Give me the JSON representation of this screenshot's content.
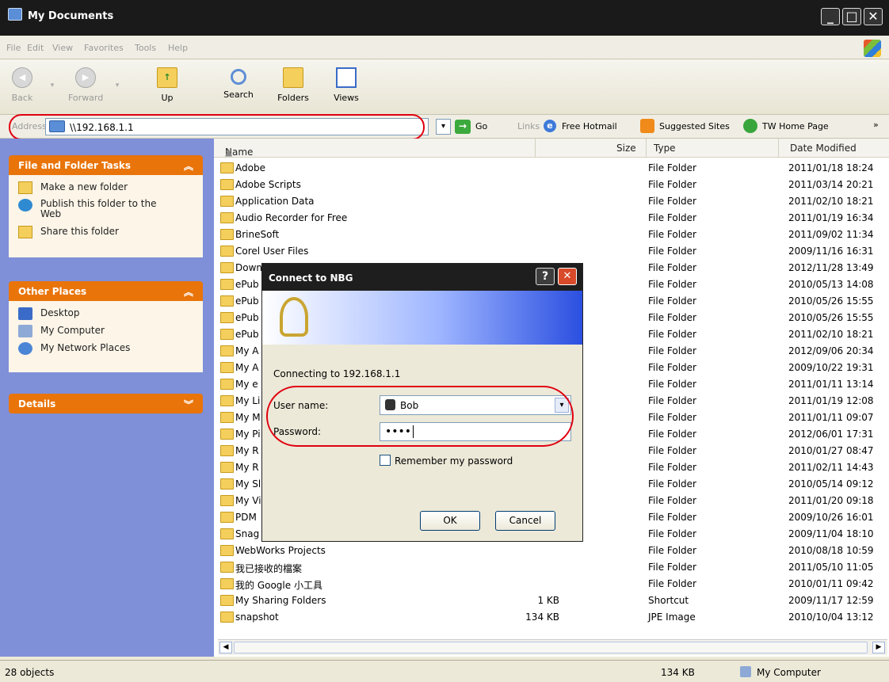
{
  "window": {
    "title": "My Documents"
  },
  "menu": [
    "File",
    "Edit",
    "View",
    "Favorites",
    "Tools",
    "Help"
  ],
  "toolbar": {
    "back": "Back",
    "forward": "Forward",
    "up": "Up",
    "search": "Search",
    "folders": "Folders",
    "views": "Views"
  },
  "address": {
    "label": "Address",
    "value": "\\\\192.168.1.1",
    "go": "Go"
  },
  "links": {
    "label": "Links",
    "items": [
      "Free Hotmail",
      "Suggested Sites",
      "TW Home Page"
    ]
  },
  "sidebar": {
    "tasks_title": "File and Folder Tasks",
    "tasks": [
      "Make a new folder",
      "Publish this folder to the Web",
      "Share this folder"
    ],
    "places_title": "Other Places",
    "places": [
      "Desktop",
      "My Computer",
      "My Network Places"
    ],
    "details_title": "Details"
  },
  "columns": {
    "name": "Name",
    "size": "Size",
    "type": "Type",
    "date": "Date Modified"
  },
  "files": [
    {
      "name": "Adobe",
      "size": "",
      "type": "File Folder",
      "date": "2011/01/18 18:24"
    },
    {
      "name": "Adobe Scripts",
      "size": "",
      "type": "File Folder",
      "date": "2011/03/14 20:21"
    },
    {
      "name": "Application Data",
      "size": "",
      "type": "File Folder",
      "date": "2011/02/10 18:21"
    },
    {
      "name": "Audio Recorder for Free",
      "size": "",
      "type": "File Folder",
      "date": "2011/01/19 16:34"
    },
    {
      "name": "BrineSoft",
      "size": "",
      "type": "File Folder",
      "date": "2011/09/02 11:34"
    },
    {
      "name": "Corel User Files",
      "size": "",
      "type": "File Folder",
      "date": "2009/11/16 16:31"
    },
    {
      "name": "Down",
      "size": "",
      "type": "File Folder",
      "date": "2012/11/28 13:49"
    },
    {
      "name": "ePub",
      "size": "",
      "type": "File Folder",
      "date": "2010/05/13 14:08"
    },
    {
      "name": "ePub",
      "size": "",
      "type": "File Folder",
      "date": "2010/05/26 15:55"
    },
    {
      "name": "ePub",
      "size": "",
      "type": "File Folder",
      "date": "2010/05/26 15:55"
    },
    {
      "name": "ePub",
      "size": "",
      "type": "File Folder",
      "date": "2011/02/10 18:21"
    },
    {
      "name": "My A",
      "size": "",
      "type": "File Folder",
      "date": "2012/09/06 20:34"
    },
    {
      "name": "My A",
      "size": "",
      "type": "File Folder",
      "date": "2009/10/22 19:31"
    },
    {
      "name": "My e",
      "size": "",
      "type": "File Folder",
      "date": "2011/01/11 13:14"
    },
    {
      "name": "My Li",
      "size": "",
      "type": "File Folder",
      "date": "2011/01/19 12:08"
    },
    {
      "name": "My M",
      "size": "",
      "type": "File Folder",
      "date": "2011/01/11 09:07"
    },
    {
      "name": "My Pi",
      "size": "",
      "type": "File Folder",
      "date": "2012/06/01 17:31"
    },
    {
      "name": "My R",
      "size": "",
      "type": "File Folder",
      "date": "2010/01/27 08:47"
    },
    {
      "name": "My R",
      "size": "",
      "type": "File Folder",
      "date": "2011/02/11 14:43"
    },
    {
      "name": "My Sl",
      "size": "",
      "type": "File Folder",
      "date": "2010/05/14 09:12"
    },
    {
      "name": "My Vi",
      "size": "",
      "type": "File Folder",
      "date": "2011/01/20 09:18"
    },
    {
      "name": "PDM",
      "size": "",
      "type": "File Folder",
      "date": "2009/10/26 16:01"
    },
    {
      "name": "Snag",
      "size": "",
      "type": "File Folder",
      "date": "2009/11/04 18:10"
    },
    {
      "name": "WebWorks Projects",
      "size": "",
      "type": "File Folder",
      "date": "2010/08/18 10:59"
    },
    {
      "name": "我已接收的檔案",
      "size": "",
      "type": "File Folder",
      "date": "2011/05/10 11:05"
    },
    {
      "name": "我的 Google 小工具",
      "size": "",
      "type": "File Folder",
      "date": "2010/01/11 09:42"
    },
    {
      "name": "My Sharing Folders",
      "size": "1 KB",
      "type": "Shortcut",
      "date": "2009/11/17 12:59"
    },
    {
      "name": "snapshot",
      "size": "134 KB",
      "type": "JPE Image",
      "date": "2010/10/04 13:12"
    }
  ],
  "status": {
    "count": "28 objects",
    "size": "134 KB",
    "location": "My Computer"
  },
  "dialog": {
    "title": "Connect to NBG",
    "connecting": "Connecting to 192.168.1.1",
    "user_label": "User name:",
    "user_value": "Bob",
    "password_label": "Password:",
    "password_value": "••••",
    "remember": "Remember my password",
    "ok": "OK",
    "cancel": "Cancel"
  }
}
